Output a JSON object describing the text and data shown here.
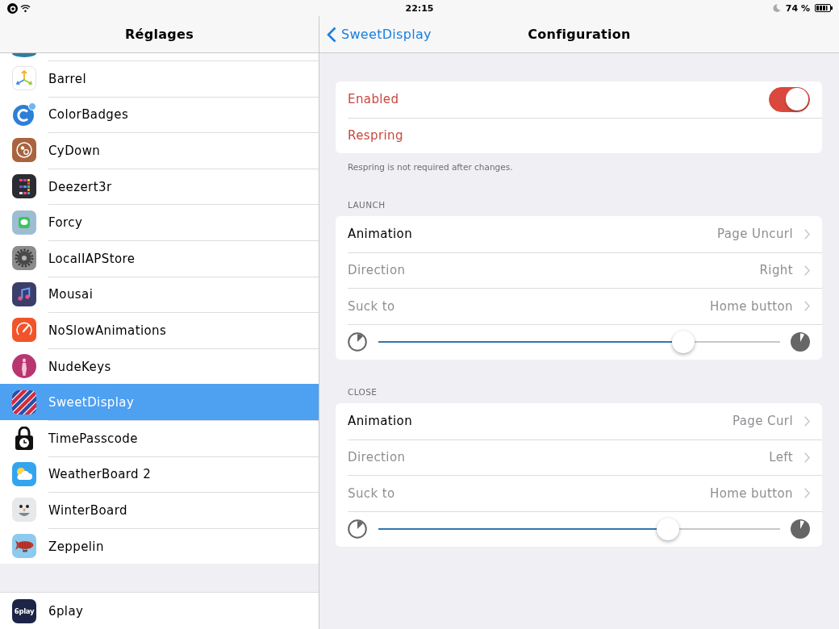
{
  "status_bar": {
    "time": "22:15",
    "battery": "74 %"
  },
  "sidebar": {
    "title": "Réglages",
    "items": [
      {
        "label": "Barrel",
        "selected": false
      },
      {
        "label": "ColorBadges",
        "selected": false
      },
      {
        "label": "CyDown",
        "selected": false
      },
      {
        "label": "Deezert3r",
        "selected": false
      },
      {
        "label": "Forcy",
        "selected": false
      },
      {
        "label": "LocalIAPStore",
        "selected": false
      },
      {
        "label": "Mousai",
        "selected": false
      },
      {
        "label": "NoSlowAnimations",
        "selected": false
      },
      {
        "label": "NudeKeys",
        "selected": false
      },
      {
        "label": "SweetDisplay",
        "selected": true
      },
      {
        "label": "TimePasscode",
        "selected": false
      },
      {
        "label": "WeatherBoard 2",
        "selected": false
      },
      {
        "label": "WinterBoard",
        "selected": false
      },
      {
        "label": "Zeppelin",
        "selected": false
      }
    ],
    "bottom_items": [
      {
        "label": "6play",
        "logo": "6play",
        "selected": false
      }
    ]
  },
  "nav_bar": {
    "back": "SweetDisplay",
    "title": "Configuration"
  },
  "groups": [
    {
      "rows": [
        {
          "kind": "switch",
          "label": "Enabled",
          "on": true
        },
        {
          "kind": "button",
          "label": "Respring"
        }
      ],
      "footer": "Respring is not required after changes."
    },
    {
      "header": "LAUNCH",
      "rows": [
        {
          "kind": "link",
          "label": "Animation",
          "value": "Page Uncurl",
          "disabled": false
        },
        {
          "kind": "link",
          "label": "Direction",
          "value": "Right",
          "disabled": true
        },
        {
          "kind": "link",
          "label": "Suck to",
          "value": "Home button",
          "disabled": true
        },
        {
          "kind": "slider",
          "level": 0.76
        }
      ]
    },
    {
      "header": "CLOSE",
      "rows": [
        {
          "kind": "link",
          "label": "Animation",
          "value": "Page Curl",
          "disabled": false
        },
        {
          "kind": "link",
          "label": "Direction",
          "value": "Left",
          "disabled": true
        },
        {
          "kind": "link",
          "label": "Suck to",
          "value": "Home button",
          "disabled": true
        },
        {
          "kind": "slider",
          "level": 0.72
        }
      ]
    }
  ]
}
